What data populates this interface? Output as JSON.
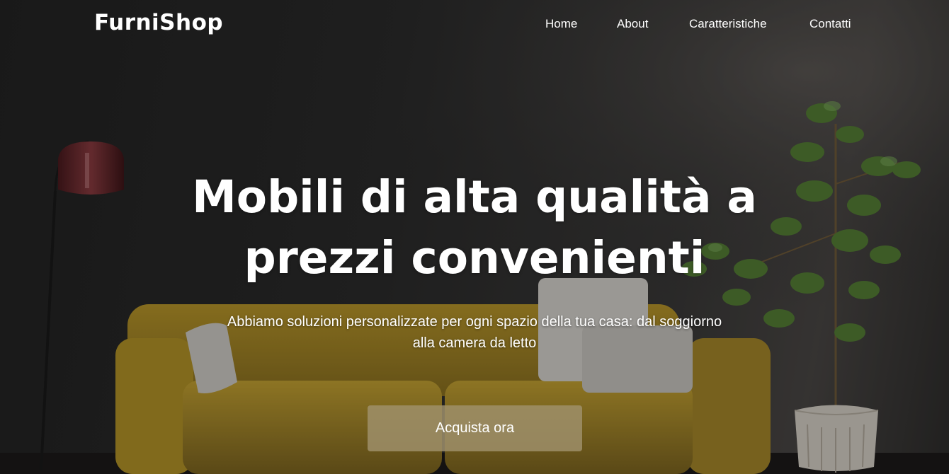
{
  "header": {
    "logo": "FurniShop",
    "nav": [
      {
        "label": "Home"
      },
      {
        "label": "About"
      },
      {
        "label": "Caratteristiche"
      },
      {
        "label": "Contatti"
      }
    ]
  },
  "hero": {
    "headline": "Mobili di alta qualità a prezzi convenienti",
    "subtitle": "Abbiamo soluzioni personalizzate per ogni spazio della tua casa: dal soggiorno alla camera da letto",
    "cta_label": "Acquista ora"
  },
  "colors": {
    "background": "#2b2b2b",
    "text": "#ffffff",
    "cta_background": "#a0916c",
    "sofa": "#c9a52f",
    "cushion": "#d9d6d1",
    "lamp_shade": "#6b2a2e",
    "plant": "#5e8a3a"
  }
}
